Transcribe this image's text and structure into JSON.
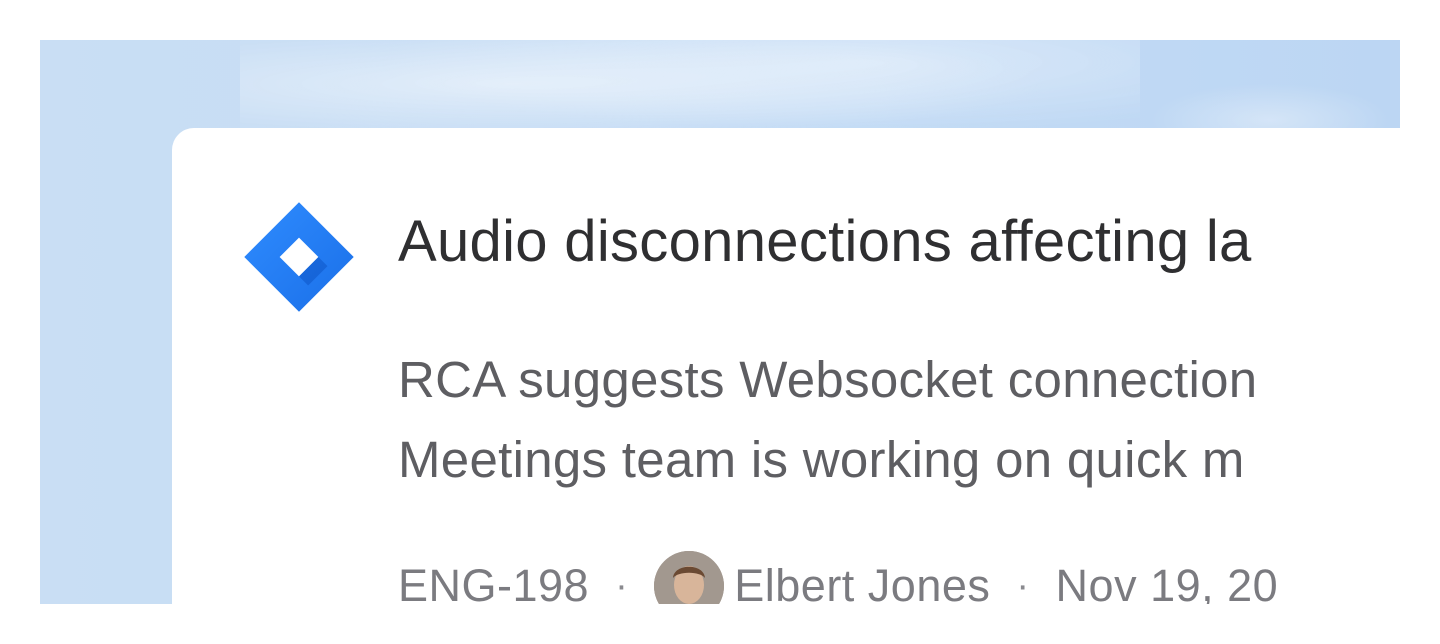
{
  "card": {
    "icon": "jira-icon",
    "title": "Audio disconnections affecting la",
    "description_line1": "RCA suggests Websocket connection",
    "description_line2": "Meetings team is working on quick m",
    "ticket_id": "ENG-198",
    "separator": "·",
    "assignee_name": "Elbert Jones",
    "date": "Nov 19, 20"
  },
  "colors": {
    "jira_blue": "#2684ff",
    "background": "#c5dcf4"
  }
}
